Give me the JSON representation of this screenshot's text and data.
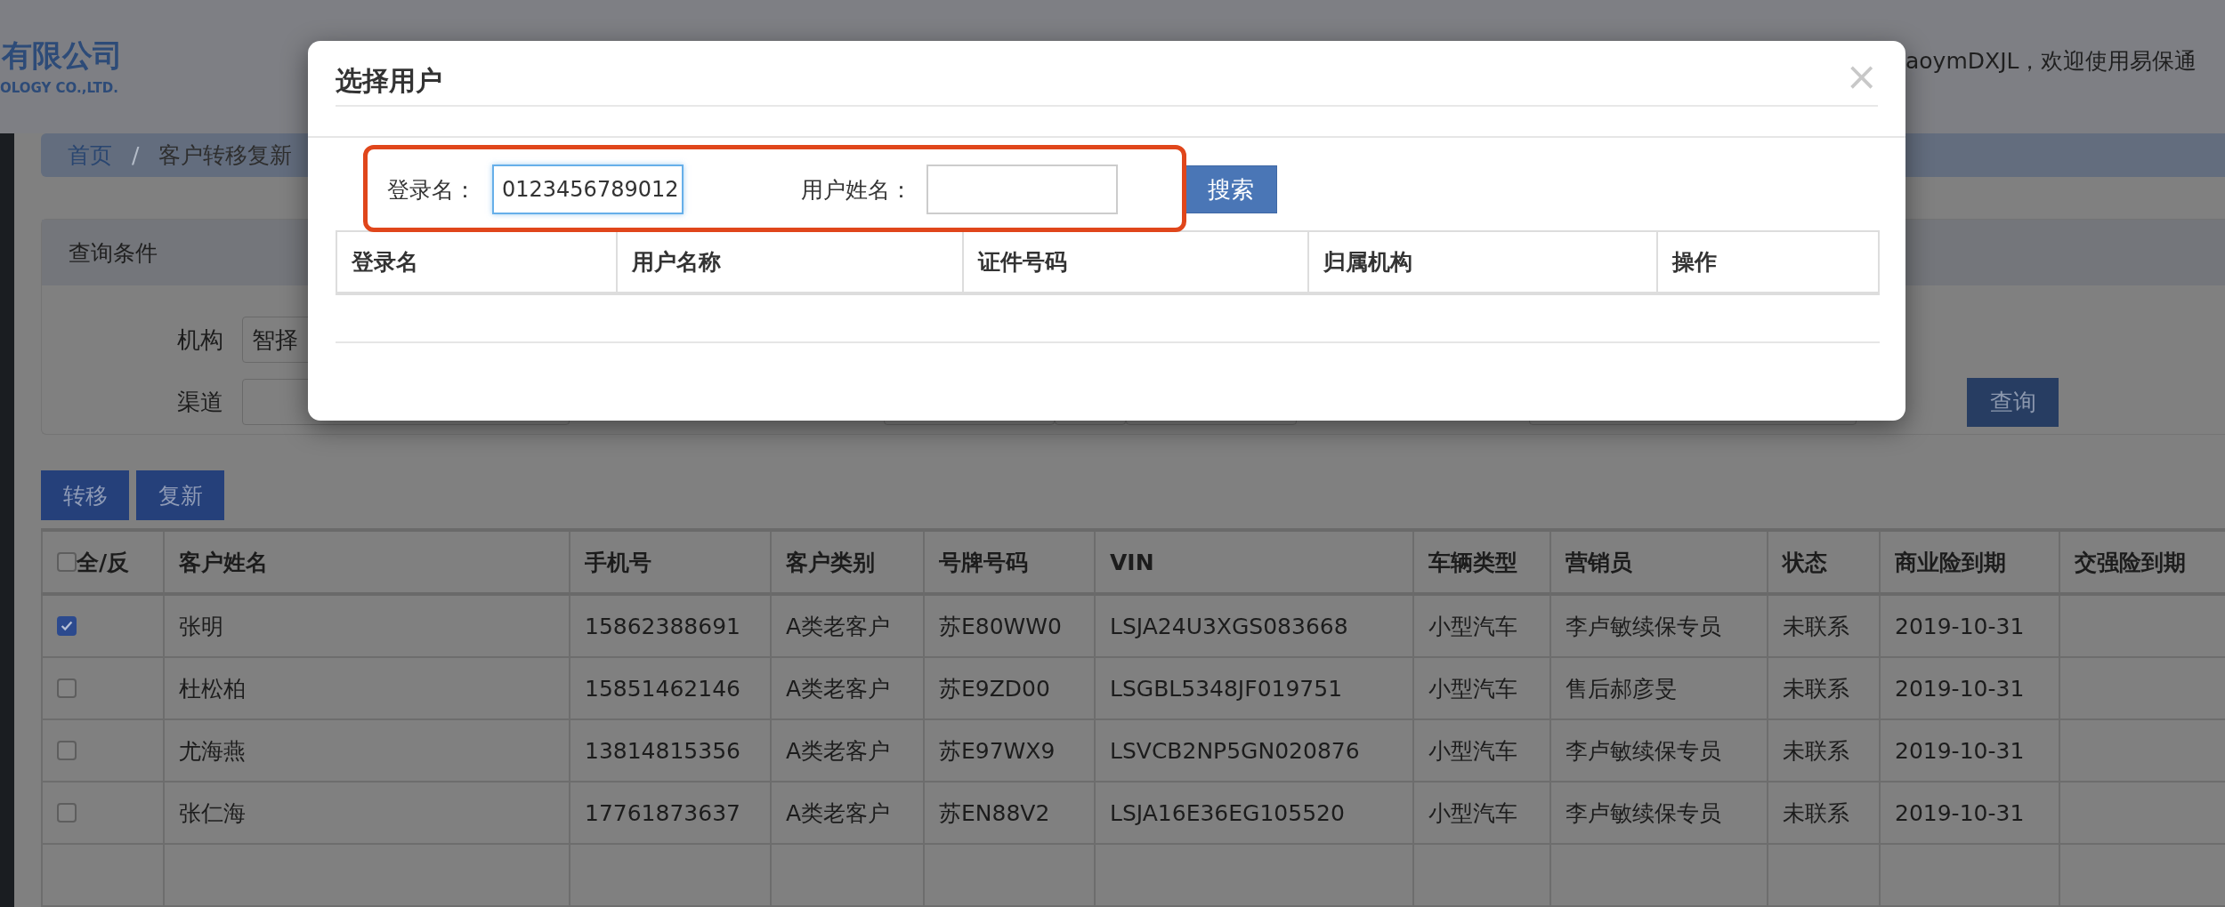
{
  "header": {
    "logo_text": "有限公司",
    "logo_subtext": "OLOGY CO.,LTD.",
    "welcome": "aoymDXJL，欢迎使用易保通"
  },
  "breadcrumb": {
    "separator": "/",
    "items": [
      {
        "label": "首页",
        "kind": "link"
      },
      {
        "label": "客户转移复新",
        "kind": "current"
      }
    ]
  },
  "query_panel": {
    "title": "查询条件",
    "fields": [
      {
        "label": "机构",
        "value": "智择"
      },
      {
        "label": "渠道"
      }
    ],
    "search_button": "查询"
  },
  "actions": [
    "转移",
    "复新"
  ],
  "table": {
    "select_all": {
      "label": "全/反",
      "checked": false
    },
    "columns": [
      "客户姓名",
      "手机号",
      "客户类别",
      "号牌号码",
      "VIN",
      "车辆类型",
      "营销员",
      "状态",
      "商业险到期",
      "交强险到期"
    ],
    "rows": [
      {
        "checked": true,
        "cells": [
          "张明",
          "15862388691",
          "A类老客户",
          "苏E80WW0",
          "LSJA24U3XGS083668",
          "小型汽车",
          "李卢敏续保专员",
          "未联系",
          "2019-10-31"
        ]
      },
      {
        "checked": false,
        "cells": [
          "杜松柏",
          "15851462146",
          "A类老客户",
          "苏E9ZD00",
          "LSGBL5348JF019751",
          "小型汽车",
          "售后郝彦旻",
          "未联系",
          "2019-10-31"
        ]
      },
      {
        "checked": false,
        "cells": [
          "尤海燕",
          "13814815356",
          "A类老客户",
          "苏E97WX9",
          "LSVCB2NP5GN020876",
          "小型汽车",
          "李卢敏续保专员",
          "未联系",
          "2019-10-31"
        ]
      },
      {
        "checked": false,
        "cells": [
          "张仁海",
          "17761873637",
          "A类老客户",
          "苏EN88V2",
          "LSJA16E36EG105520",
          "小型汽车",
          "李卢敏续保专员",
          "未联系",
          "2019-10-31"
        ]
      }
    ]
  },
  "modal": {
    "title": "选择用户",
    "close": "×",
    "fields": [
      {
        "label": "登录名：",
        "value": "0123456789012",
        "focused": true
      },
      {
        "label": "用户姓名：",
        "focused": false
      }
    ],
    "search_button": "搜索",
    "columns": [
      "登录名",
      "用户名称",
      "证件号码",
      "归属机构",
      "操作"
    ]
  }
}
